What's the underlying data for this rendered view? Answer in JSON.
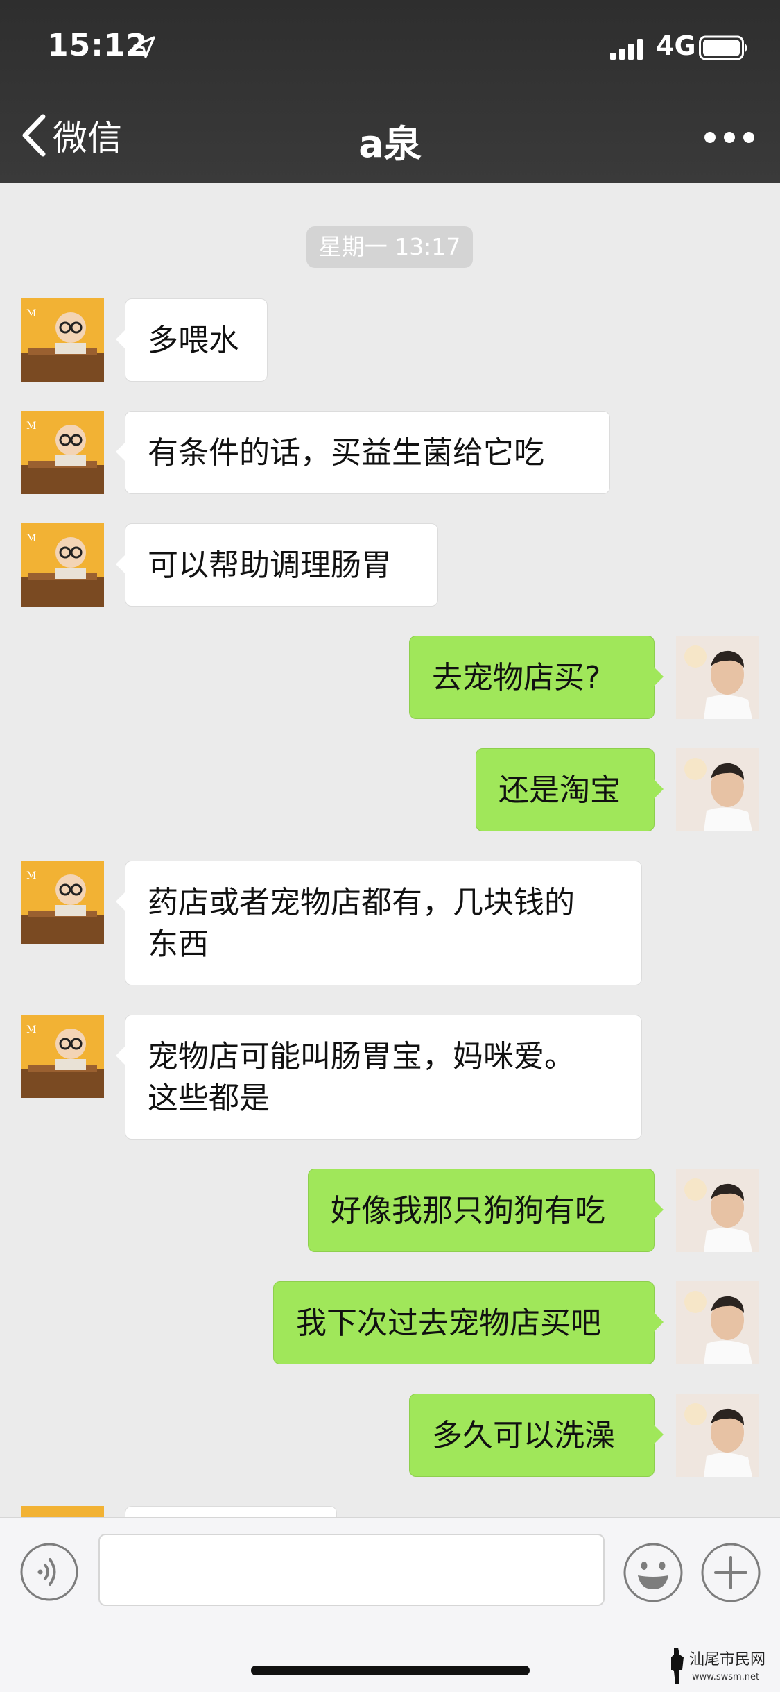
{
  "status_bar": {
    "time": "15:12",
    "network": "4G"
  },
  "nav": {
    "back_label": "微信",
    "title": "a泉"
  },
  "timestamp": "星期一 13:17",
  "messages": [
    {
      "side": "left",
      "lines": [
        "多喂水"
      ]
    },
    {
      "side": "left",
      "lines": [
        "有条件的话，买益生菌给它吃"
      ]
    },
    {
      "side": "left",
      "lines": [
        "可以帮助调理肠胃"
      ]
    },
    {
      "side": "right",
      "lines": [
        "去宠物店买?"
      ]
    },
    {
      "side": "right",
      "lines": [
        "还是淘宝"
      ]
    },
    {
      "side": "left",
      "lines": [
        "药店或者宠物店都有，几块钱的",
        "东西"
      ]
    },
    {
      "side": "left",
      "lines": [
        "宠物店可能叫肠胃宝，妈咪爱。",
        "这些都是"
      ]
    },
    {
      "side": "right",
      "lines": [
        "好像我那只狗狗有吃"
      ]
    },
    {
      "side": "right",
      "lines": [
        "我下次过去宠物店买吧"
      ]
    },
    {
      "side": "right",
      "lines": [
        "多久可以洗澡"
      ]
    }
  ],
  "input": {
    "value": ""
  },
  "watermark": {
    "text": "汕尾市民网",
    "url": "www.swsm.net"
  },
  "colors": {
    "sent_bubble": "#a0e75a",
    "received_bubble": "#ffffff",
    "background": "#ebebeb"
  }
}
